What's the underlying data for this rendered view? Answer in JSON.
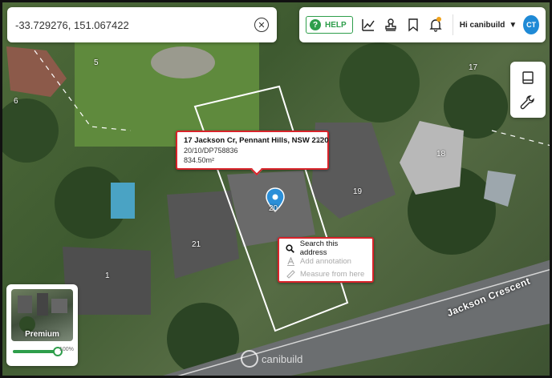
{
  "search": {
    "value": "-33.729276, 151.067422",
    "clear_icon": "close-circle-icon"
  },
  "toolbar": {
    "help_label": "HELP",
    "icons": [
      "chart-icon",
      "stamp-icon",
      "bookmark-icon",
      "bell-icon"
    ],
    "user_greeting": "Hi canibuild",
    "avatar_initials": "CT",
    "accent_color": "#2e9e4b",
    "avatar_color": "#1f8ad6"
  },
  "side_tools": {
    "icons": [
      "book-icon",
      "wrench-icon"
    ]
  },
  "popup": {
    "address": "17 Jackson Cr, Pennant Hills, NSW 2120",
    "lot": "20/10/DP758836",
    "area": "834.50m²",
    "highlight_color": "#d8232a"
  },
  "context_menu": {
    "items": [
      {
        "label": "Search this address",
        "icon": "search-icon",
        "enabled": true
      },
      {
        "label": "Add annotation",
        "icon": "annotation-icon",
        "enabled": false
      },
      {
        "label": "Measure from here",
        "icon": "ruler-icon",
        "enabled": false
      }
    ]
  },
  "map": {
    "street_name": "Jackson Crescent",
    "lot_numbers": [
      "5",
      "6",
      "17",
      "18",
      "19",
      "20",
      "21",
      "1"
    ],
    "pin_color": "#2b8fd8"
  },
  "layer_panel": {
    "layer_name": "Premium",
    "opacity_fraction": 1.0,
    "opacity_label": "100%"
  },
  "watermark": {
    "text": "canibuild"
  }
}
